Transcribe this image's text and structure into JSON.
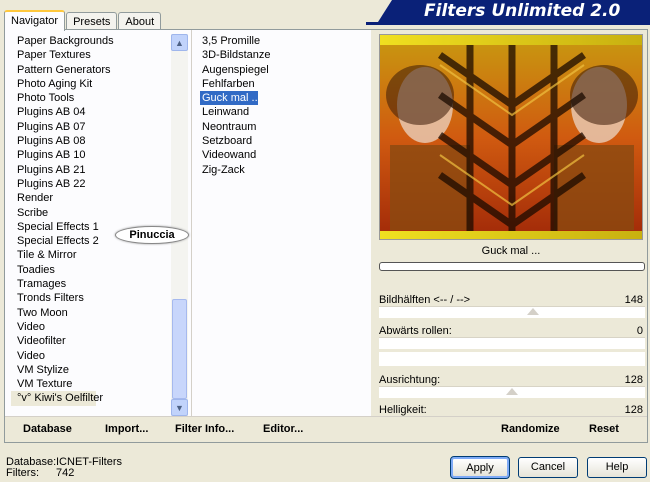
{
  "tabs": [
    {
      "label": "Navigator",
      "active": true
    },
    {
      "label": "Presets",
      "active": false
    },
    {
      "label": "About",
      "active": false
    }
  ],
  "app_title": "Filters Unlimited 2.0",
  "categories": [
    "Paper Backgrounds",
    "Paper Textures",
    "Pattern Generators",
    "Photo Aging Kit",
    "Photo Tools",
    "Plugins AB 04",
    "Plugins AB 07",
    "Plugins AB 08",
    "Plugins AB 10",
    "Plugins AB 21",
    "Plugins AB 22",
    "Render",
    "Scribe",
    "Special Effects 1",
    "Special Effects 2",
    "Tile & Mirror",
    "Toadies",
    "Tramages",
    "Tronds Filters",
    "Two Moon",
    "Video",
    "Videofilter",
    "Video",
    "VM Stylize",
    "VM Texture",
    "°v° Kiwi's Oelfilter"
  ],
  "selected_category": "°v° Kiwi's Oelfilter",
  "filters": [
    "3,5 Promille",
    "3D-Bildstanze",
    "Augenspiegel",
    "Fehlfarben",
    "Guck mal ...",
    "Leinwand",
    "Neontraum",
    "Setzboard",
    "Videowand",
    "Zig-Zack"
  ],
  "selected_filter": "Guck mal ...",
  "watermark": "Pinuccia",
  "preview_label": "Guck mal ...",
  "params": [
    {
      "label": "Bildhälften <-- / -->",
      "value": "148",
      "level": 0.58
    },
    {
      "label": "Abwärts rollen:",
      "value": "0",
      "level": 0
    },
    {
      "label": "Ausrichtung:",
      "value": "128",
      "level": 0.5
    },
    {
      "label": "Helligkeit:",
      "value": "128",
      "level": 0.5
    }
  ],
  "toolbar": {
    "database": "Database",
    "import": "Import...",
    "filter_info": "Filter Info...",
    "editor": "Editor...",
    "randomize": "Randomize",
    "reset": "Reset"
  },
  "db_info": {
    "database_key": "Database:",
    "database_value": "ICNET-Filters",
    "filters_key": "Filters:",
    "filters_value": "742"
  },
  "buttons": {
    "apply": "Apply",
    "cancel": "Cancel",
    "help": "Help"
  },
  "colors": {
    "title_bar": "#0a2178",
    "selection": "#316ac5",
    "tab_highlight": "#ffc83c"
  }
}
